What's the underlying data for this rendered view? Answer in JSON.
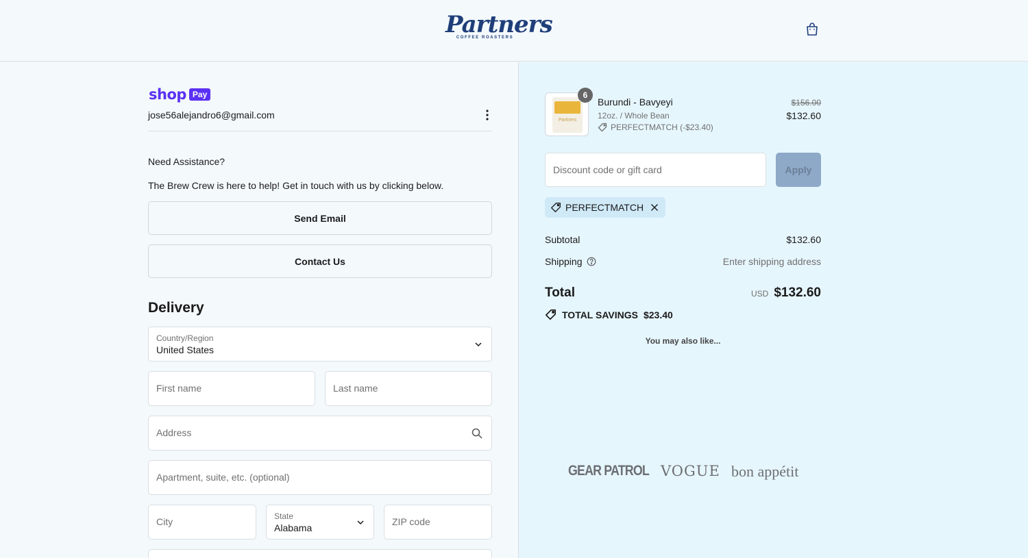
{
  "header": {
    "brand_name": "Partners",
    "brand_tagline": "COFFEE ROASTERS",
    "cart_icon": "shopping-bag-icon"
  },
  "account": {
    "shop_word": "shop",
    "pay_badge": "Pay",
    "email": "jose56alejandro6@gmail.com",
    "menu_icon": "more-vertical-icon"
  },
  "assistance": {
    "title": "Need Assistance?",
    "text": "The Brew Crew is here to help! Get in touch with us by clicking below.",
    "send_email_label": "Send Email",
    "contact_us_label": "Contact Us"
  },
  "delivery": {
    "heading": "Delivery",
    "country_label": "Country/Region",
    "country_value": "United States",
    "first_name_placeholder": "First name",
    "last_name_placeholder": "Last name",
    "address_placeholder": "Address",
    "apartment_placeholder": "Apartment, suite, etc. (optional)",
    "city_placeholder": "City",
    "state_label": "State",
    "state_value": "Alabama",
    "zip_placeholder": "ZIP code"
  },
  "order": {
    "item": {
      "quantity": "6",
      "name": "Burundi - Bavyeyi",
      "variant": "12oz. / Whole Bean",
      "discount": "PERFECTMATCH (-$23.40)",
      "original_price": "$156.00",
      "price": "$132.60"
    },
    "discount_placeholder": "Discount code or gift card",
    "apply_label": "Apply",
    "applied_code": "PERFECTMATCH",
    "subtotal_label": "Subtotal",
    "subtotal_value": "$132.60",
    "shipping_label": "Shipping",
    "shipping_value": "Enter shipping address",
    "total_label": "Total",
    "total_currency": "USD",
    "total_value": "$132.60",
    "savings_label": "TOTAL SAVINGS",
    "savings_value": "$23.40",
    "also_like": "You may also like..."
  },
  "press": {
    "gear_patrol": "GEAR PATROL",
    "vogue": "VOGUE",
    "bon_appetit": "bon appétit"
  },
  "colors": {
    "brand": "#1f3e7a",
    "shop_pay": "#5a31f4",
    "summary_bg": "#e6f6fd",
    "apply_disabled": "#8ea8c8"
  }
}
